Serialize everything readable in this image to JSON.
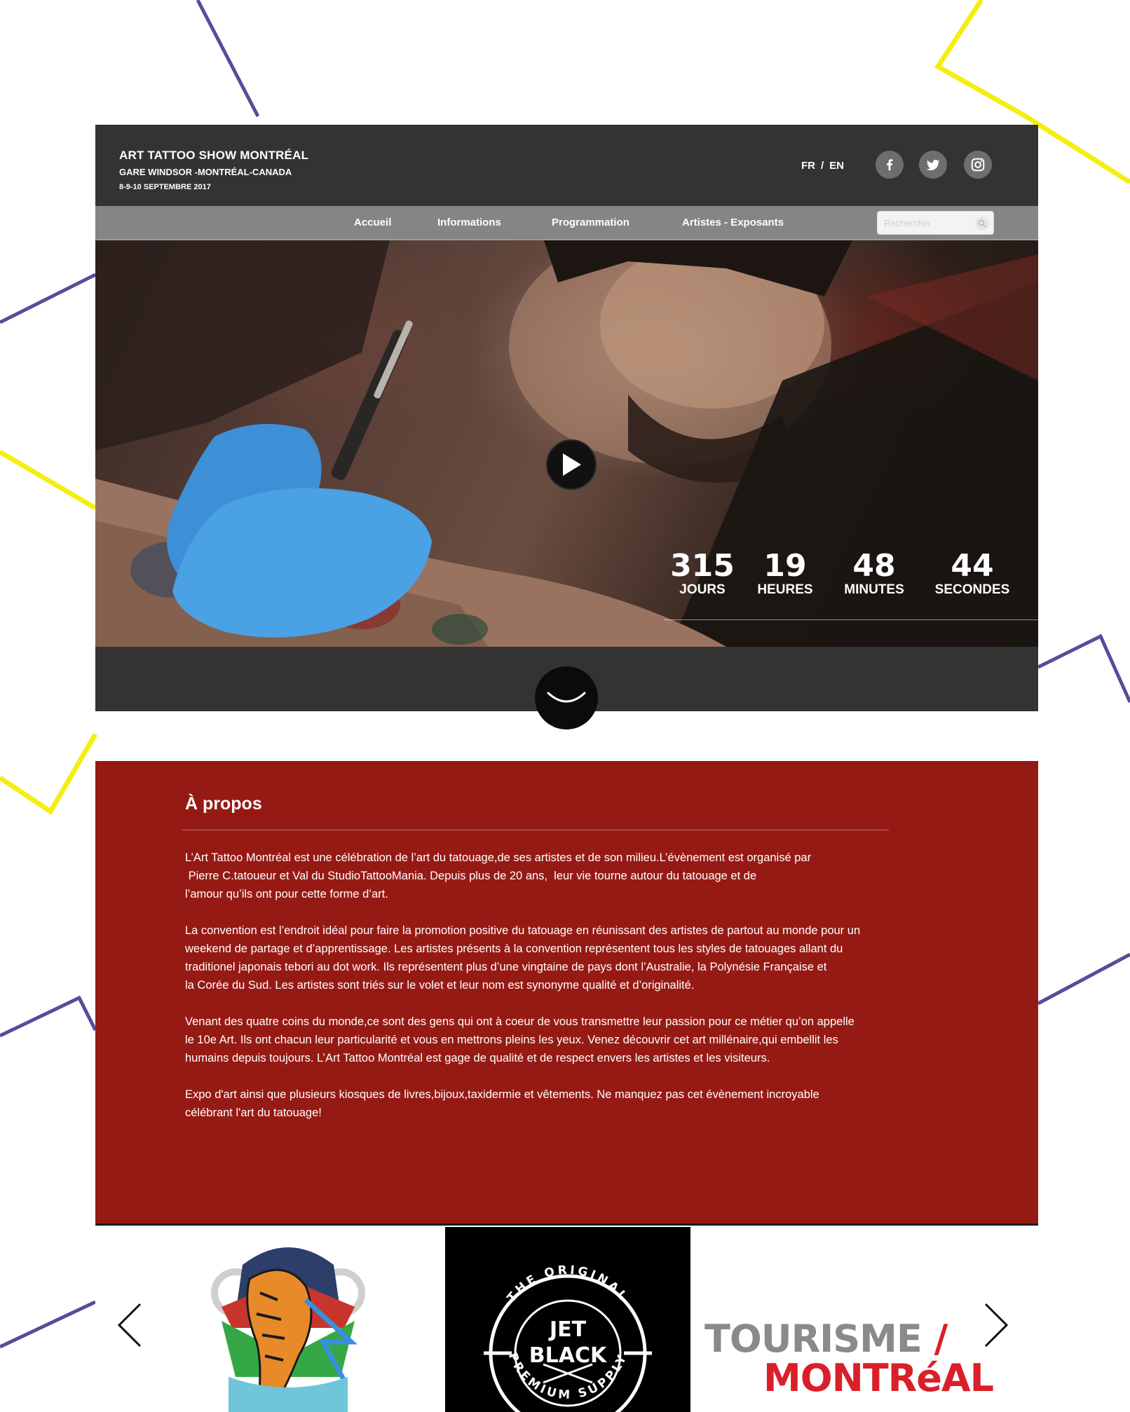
{
  "header": {
    "title": "ART TATTOO SHOW MONTRÉAL",
    "location": "GARE WINDSOR -MONTRÉAL-CANADA",
    "dates": "8-9-10 SEPTEMBRE 2017",
    "lang_fr": "FR",
    "lang_sep": "/",
    "lang_en": "EN",
    "social_icons": [
      "facebook-icon",
      "twitter-icon",
      "instagram-icon"
    ]
  },
  "nav": {
    "items": [
      "Accueil",
      "Informations",
      "Programmation",
      "Artistes - Exposants"
    ],
    "search_placeholder": "Rechercher"
  },
  "hero": {
    "countdown": [
      {
        "value": "315",
        "label": "JOURS"
      },
      {
        "value": "19",
        "label": "HEURES"
      },
      {
        "value": "48",
        "label": "MINUTES"
      },
      {
        "value": "44",
        "label": "SECONDES"
      }
    ]
  },
  "about": {
    "title": "À propos",
    "paragraphs": [
      [
        "L’Art Tattoo Montréal est une célébration de l’art du tatouage,de ses artistes et de son milieu.L’évènement est organisé par",
        " Pierre C.tatoueur et Val du StudioTattooMania. Depuis plus de 20 ans,  leur vie tourne autour du tatouage et de",
        "l’amour qu’ils ont pour cette forme d’art."
      ],
      [
        "La convention est l’endroit idéal pour faire la promotion positive du tatouage en réunissant des artistes de partout au monde pour un",
        "weekend de partage et d’apprentissage. Les artistes présents à la convention représentent tous les styles de tatouages allant du",
        "traditionel japonais tebori au dot work. Ils représentent plus d’une vingtaine de pays dont l’Australie, la Polynésie Française et",
        "la Corée du Sud. Les artistes sont triés sur le volet et leur nom est synonyme qualité et d’originalité."
      ],
      [
        "Venant des quatre coins du monde,ce sont des gens qui ont à coeur de vous transmettre leur passion pour ce métier qu’on appelle",
        "le 10e Art. Ils ont chacun leur particularité et vous en mettrons pleins les yeux. Venez découvrir cet art millénaire,qui embellit les",
        "humains depuis toujours. L’Art Tattoo Montréal est gage de qualité et de respect envers les artistes et les visiteurs."
      ],
      [
        "Expo d'art ainsi que plusieurs kiosques de livres,bijoux,taxidermie et vêtements. Ne manquez pas cet évènement incroyable",
        "célébrant l'art du tatouage!"
      ]
    ]
  },
  "partners": {
    "jet_black": {
      "arc_top": "THE ORIGINAL",
      "line1": "JET",
      "line2": "BLACK",
      "arc_bottom": "PREMIUM SUPPLY"
    },
    "tourisme": {
      "line1": "TOURISME",
      "slash": "/",
      "line2": "MONTRéAL"
    }
  },
  "colors": {
    "header_bg": "#333333",
    "nav_bg": "#858585",
    "about_bg": "#961a14",
    "deco_purple": "#5b4a9a",
    "deco_yellow": "#f5ee10"
  }
}
